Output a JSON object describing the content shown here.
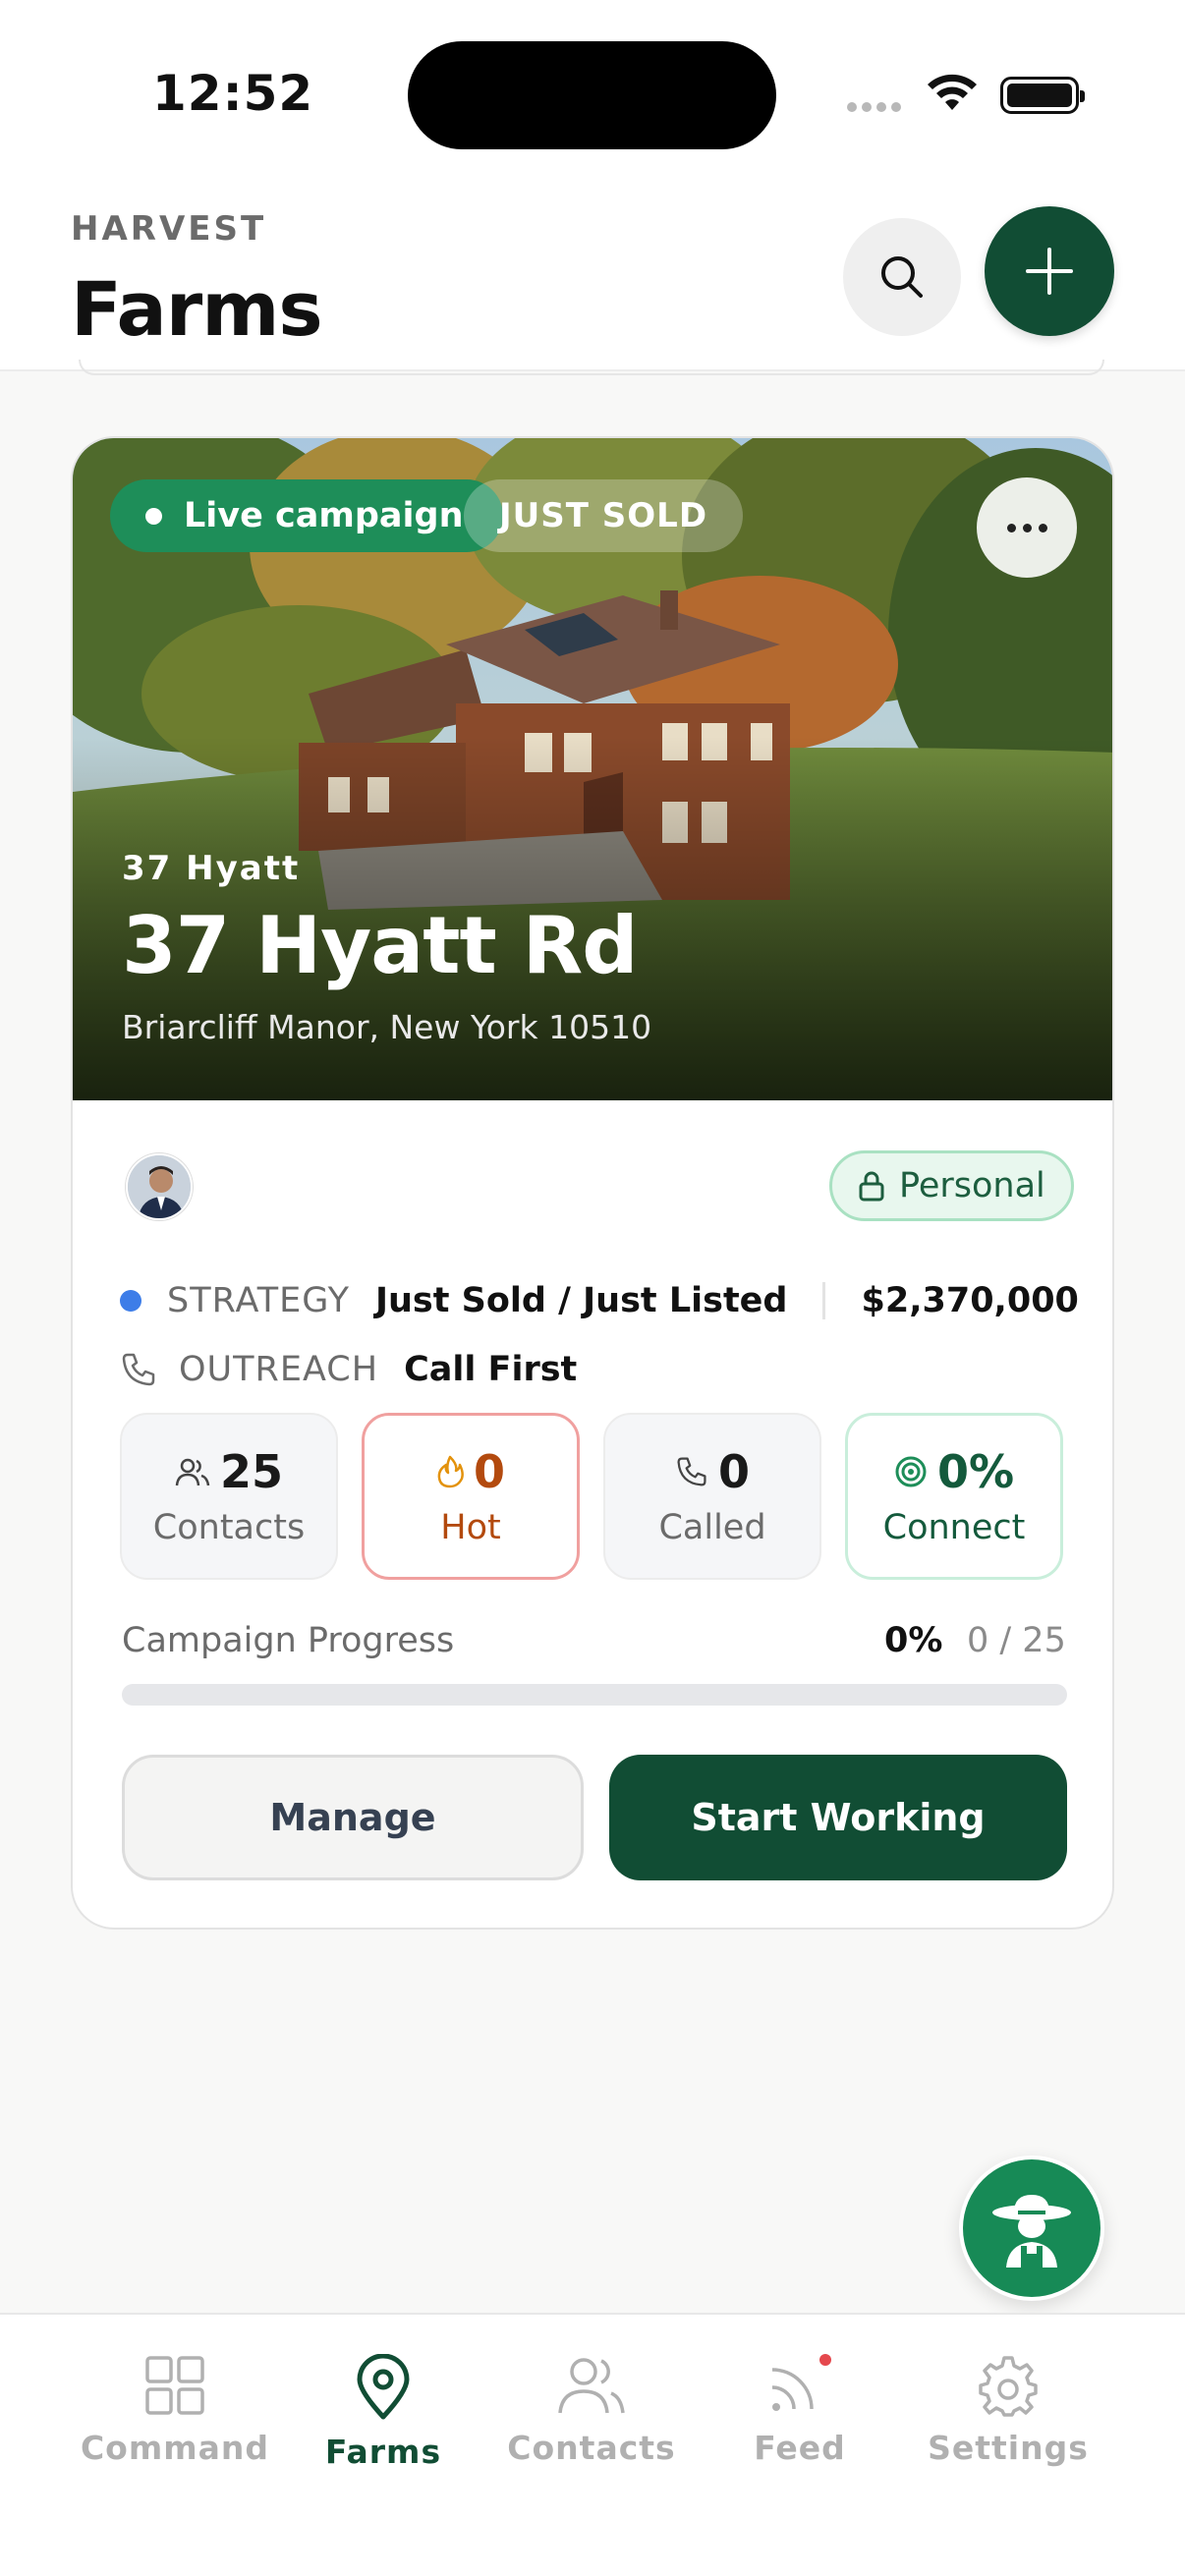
{
  "status_bar": {
    "time": "12:52"
  },
  "header": {
    "eyebrow": "HARVEST",
    "title": "Farms"
  },
  "campaign_card": {
    "badges": {
      "live": "Live campaign",
      "type": "JUST SOLD"
    },
    "short_name": "37 Hyatt",
    "address_title": "37 Hyatt Rd",
    "city_line": "Briarcliff Manor, New York 10510",
    "visibility": "Personal",
    "strategy": {
      "label": "STRATEGY",
      "value": "Just Sold / Just Listed",
      "price": "$2,370,000"
    },
    "outreach": {
      "label": "OUTREACH",
      "value": "Call First"
    },
    "stats": [
      {
        "value": "25",
        "label": "Contacts",
        "icon": "people-icon"
      },
      {
        "value": "0",
        "label": "Hot",
        "icon": "flame-icon"
      },
      {
        "value": "0",
        "label": "Called",
        "icon": "phone-icon"
      },
      {
        "value": "0%",
        "label": "Connect",
        "icon": "target-icon"
      }
    ],
    "progress": {
      "label": "Campaign Progress",
      "percent": "0%",
      "count": "0 / 25",
      "fraction": 0
    },
    "actions": {
      "manage": "Manage",
      "start": "Start Working"
    }
  },
  "tabbar": {
    "items": [
      {
        "label": "Command",
        "icon": "grid-icon",
        "active": false
      },
      {
        "label": "Farms",
        "icon": "map-pin-icon",
        "active": true
      },
      {
        "label": "Contacts",
        "icon": "contacts-icon",
        "active": false
      },
      {
        "label": "Feed",
        "icon": "rss-icon",
        "active": false
      },
      {
        "label": "Settings",
        "icon": "gear-icon",
        "active": false
      }
    ]
  },
  "colors": {
    "brand": "#114d34",
    "live": "#1e8e59",
    "hot": "#b34a0e",
    "strategy_dot": "#3d7de8"
  }
}
